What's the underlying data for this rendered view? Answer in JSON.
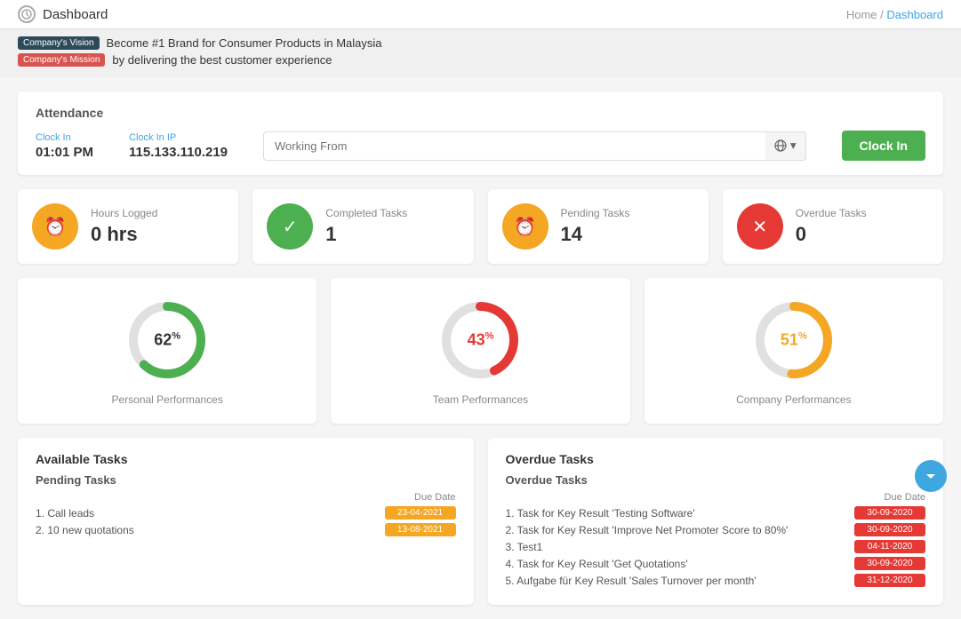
{
  "nav": {
    "title": "Dashboard",
    "breadcrumb_home": "Home",
    "breadcrumb_sep": "/",
    "breadcrumb_current": "Dashboard"
  },
  "banners": {
    "vision_badge": "Company's Vision",
    "vision_text": "Become #1 Brand for Consumer Products in Malaysia",
    "mission_badge": "Company's Mission",
    "mission_text": "by delivering the best customer experience"
  },
  "attendance": {
    "title": "Attendance",
    "clock_in_label": "Clock In",
    "clock_in_value": "01:01 PM",
    "clock_in_ip_label": "Clock In IP",
    "clock_in_ip_value": "115.133.110.219",
    "working_from_placeholder": "Working From",
    "clock_in_btn": "Clock In"
  },
  "stats": [
    {
      "label": "Hours Logged",
      "value": "0 hrs",
      "icon": "⏰",
      "color": "yellow"
    },
    {
      "label": "Completed Tasks",
      "value": "1",
      "icon": "✓",
      "color": "green"
    },
    {
      "label": "Pending Tasks",
      "value": "14",
      "icon": "⏰",
      "color": "orange"
    },
    {
      "label": "Overdue Tasks",
      "value": "0",
      "icon": "✕",
      "color": "red"
    }
  ],
  "performances": [
    {
      "label": "Personal Performances",
      "percent": 62,
      "color_main": "#4caf50",
      "color_track": "#e0e0e0",
      "color_text": "#333"
    },
    {
      "label": "Team Performances",
      "percent": 43,
      "color_main": "#e53935",
      "color_track": "#e0e0e0",
      "color_text": "#e53935"
    },
    {
      "label": "Company Performances",
      "percent": 51,
      "color_main": "#f5a623",
      "color_track": "#e0e0e0",
      "color_text": "#f5a623"
    }
  ],
  "available_tasks": {
    "section_title": "Available Tasks",
    "sub_title": "Pending Tasks",
    "due_date_label": "Due Date",
    "tasks": [
      {
        "name": "1. Call leads",
        "due": "23-04-2021"
      },
      {
        "name": "2. 10 new quotations",
        "due": "13-08-2021"
      }
    ]
  },
  "overdue_tasks": {
    "section_title": "Overdue Tasks",
    "sub_title": "Overdue Tasks",
    "due_date_label": "Due Date",
    "tasks": [
      {
        "name": "1. Task for Key Result 'Testing Software'",
        "due": "30-09-2020"
      },
      {
        "name": "2. Task for Key Result 'Improve Net Promoter Score to 80%'",
        "due": "30-09-2020"
      },
      {
        "name": "3. Test1",
        "due": "04-11-2020"
      },
      {
        "name": "4. Task for Key Result 'Get Quotations'",
        "due": "30-09-2020"
      },
      {
        "name": "5. Aufgabe für Key Result 'Sales Turnover per month'",
        "due": "31-12-2020"
      }
    ]
  }
}
